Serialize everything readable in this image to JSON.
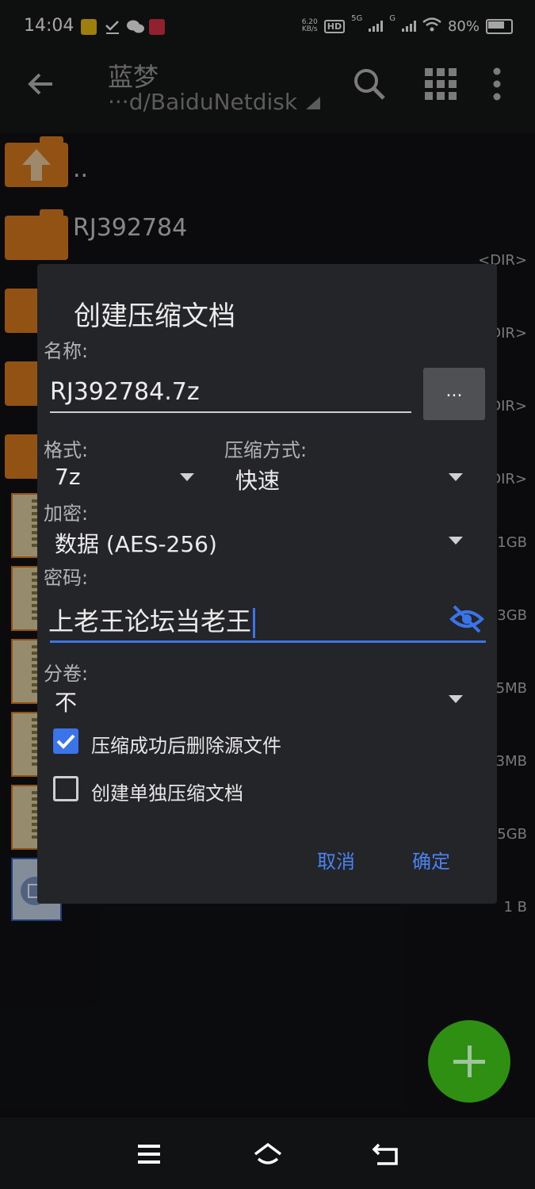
{
  "status_bar": {
    "time": "14:04",
    "net_speed_value": "6.20",
    "net_speed_unit": "KB/s",
    "hd_label": "HD",
    "sim1_label": "5G",
    "sim2_label": "G",
    "battery": "80%",
    "app_icon_colors": [
      "#f2c318",
      "#ffffff",
      "#ffffff",
      "#e0344a"
    ]
  },
  "toolbar": {
    "title": "蓝梦",
    "path": "···d/BaiduNetdisk"
  },
  "files": [
    {
      "kind": "up-folder",
      "name": "..",
      "meta": ""
    },
    {
      "kind": "folder",
      "name": "RJ392784",
      "meta": "<DIR>"
    },
    {
      "kind": "folder",
      "name": "",
      "meta": "DIR>"
    },
    {
      "kind": "folder",
      "name": "",
      "meta": "DIR>"
    },
    {
      "kind": "folder",
      "name": "",
      "meta": "DIR>"
    },
    {
      "kind": "zip",
      "name": "",
      "meta": "1GB"
    },
    {
      "kind": "zip",
      "name": "",
      "meta": "3GB"
    },
    {
      "kind": "zip",
      "name": "",
      "meta": "5MB"
    },
    {
      "kind": "zip",
      "name": "",
      "meta": "3MB"
    },
    {
      "kind": "zip",
      "name": "",
      "meta": "5GB"
    },
    {
      "kind": "doc",
      "name": "",
      "meta": "1 B"
    }
  ],
  "dialog": {
    "title": "创建压缩文档",
    "name_label": "名称:",
    "name_value": "RJ392784.7z",
    "more_button": "...",
    "format_label": "格式:",
    "format_value": "7z",
    "method_label": "压缩方式:",
    "method_value": "快速",
    "encrypt_label": "加密:",
    "encrypt_value": "数据 (AES-256)",
    "password_label": "密码:",
    "password_value": "上老王论坛当老王",
    "split_label": "分卷:",
    "split_value": "不",
    "delete_source_label": "压缩成功后删除源文件",
    "delete_source_checked": true,
    "separate_archive_label": "创建单独压缩文档",
    "separate_archive_checked": false,
    "cancel_label": "取消",
    "ok_label": "确定"
  },
  "colors": {
    "accent": "#3a74e8",
    "folder": "#e07e1e",
    "fab": "#2f8f12",
    "dialog_bg": "#232528"
  },
  "icons": {
    "back": "arrow-left-icon",
    "search": "search-icon",
    "grid": "grid-view-icon",
    "more": "more-vert-icon",
    "visibility": "eye-off-icon",
    "fab": "plus-icon"
  }
}
